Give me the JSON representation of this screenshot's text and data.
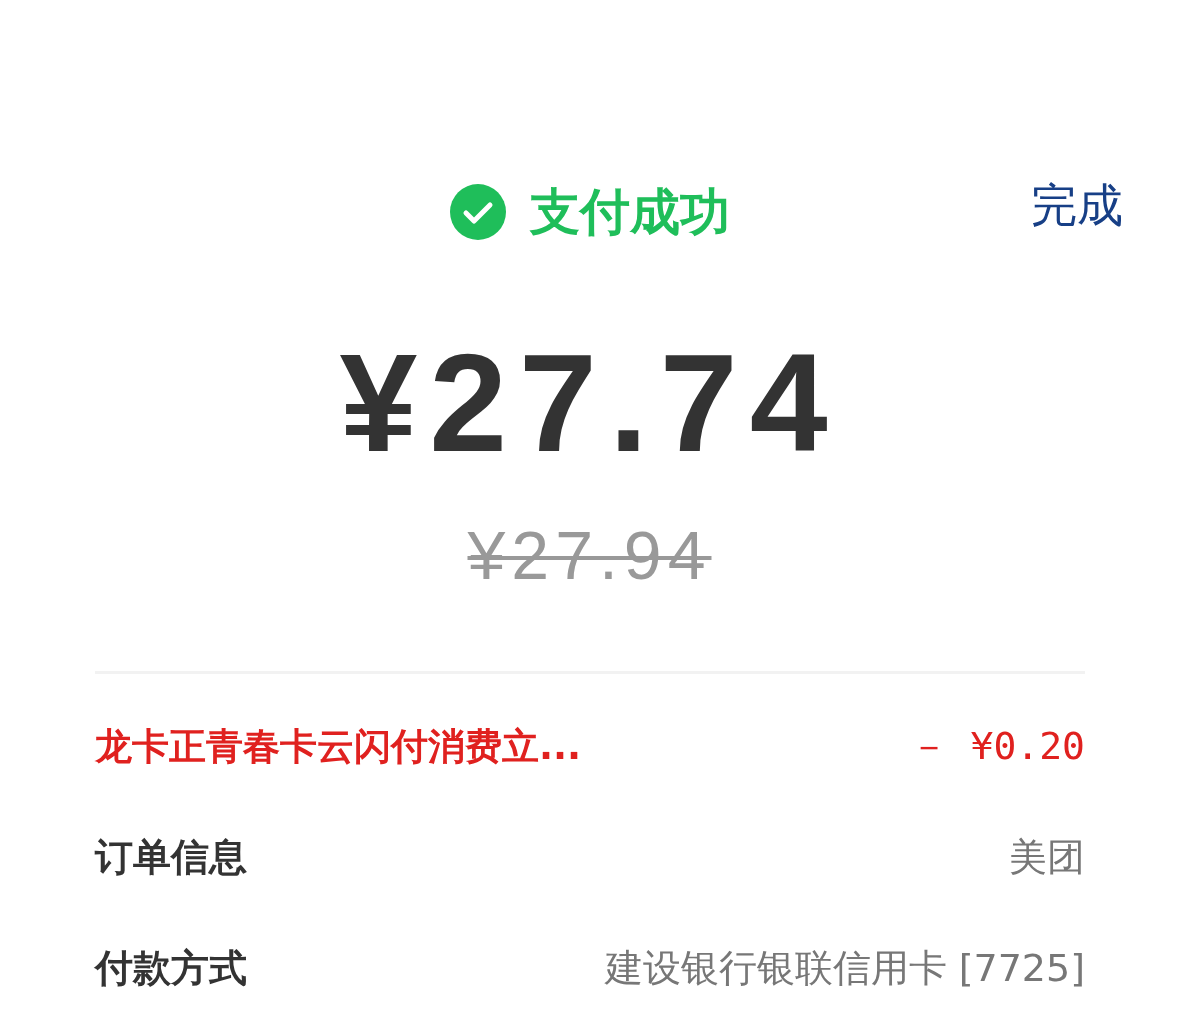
{
  "header": {
    "status": "支付成功",
    "done_button": "完成"
  },
  "amount": "¥27.74",
  "original_amount": {
    "text": "¥27.94",
    "struck": true
  },
  "rows": [
    {
      "kind": "discount",
      "label": "龙卡正青春卡云闪付消费立...",
      "value": "－ ¥0.20"
    },
    {
      "kind": "info",
      "label": "订单信息",
      "value": "美团"
    },
    {
      "kind": "info",
      "label": "付款方式",
      "value": "建设银行银联信用卡 [7725]"
    }
  ]
}
